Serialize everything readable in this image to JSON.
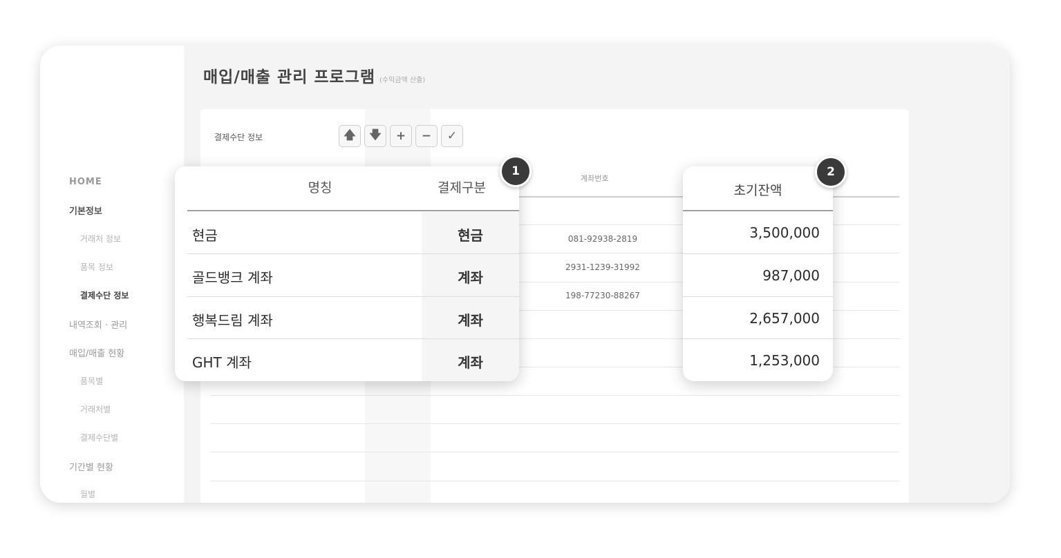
{
  "sidebar": {
    "home": "HOME",
    "basic_info": "기본정보",
    "client_info": "거래처 정보",
    "item_info": "품목 정보",
    "payment_info": "결제수단 정보",
    "history": "내역조회 · 관리",
    "purchase_sales_status": "매입/매출 현황",
    "by_item": "품목별",
    "by_client": "거래처별",
    "by_payment": "결제수단별",
    "period_status": "기간별 현황",
    "monthly": "월별"
  },
  "main": {
    "title": "매입/매출 관리 프로그램",
    "subtitle": "(수익금액 산출)",
    "panel_title": "결제수단 정보",
    "toolbar": {
      "up": "🡅",
      "down": "🡇",
      "add": "+",
      "remove": "−",
      "confirm": "✓"
    },
    "background_table": {
      "account_header": "계좌번호",
      "accounts": [
        "081-92938-2819",
        "2931-1239-31992",
        "198-77230-88267"
      ]
    }
  },
  "callout1": {
    "badge": "1",
    "headers": {
      "name": "명칭",
      "type": "결제구분"
    },
    "rows": [
      {
        "name": "현금",
        "type": "현금"
      },
      {
        "name": "골드뱅크 계좌",
        "type": "계좌"
      },
      {
        "name": "행복드림 계좌",
        "type": "계좌"
      },
      {
        "name": "GHT 계좌",
        "type": "계좌"
      }
    ]
  },
  "callout2": {
    "badge": "2",
    "header": "초기잔액",
    "values": [
      "3,500,000",
      "987,000",
      "2,657,000",
      "1,253,000"
    ]
  },
  "colors": {
    "badge": "#3a3a3a",
    "page_bg": "#f4f4f4",
    "panel_bg": "#ffffff"
  }
}
